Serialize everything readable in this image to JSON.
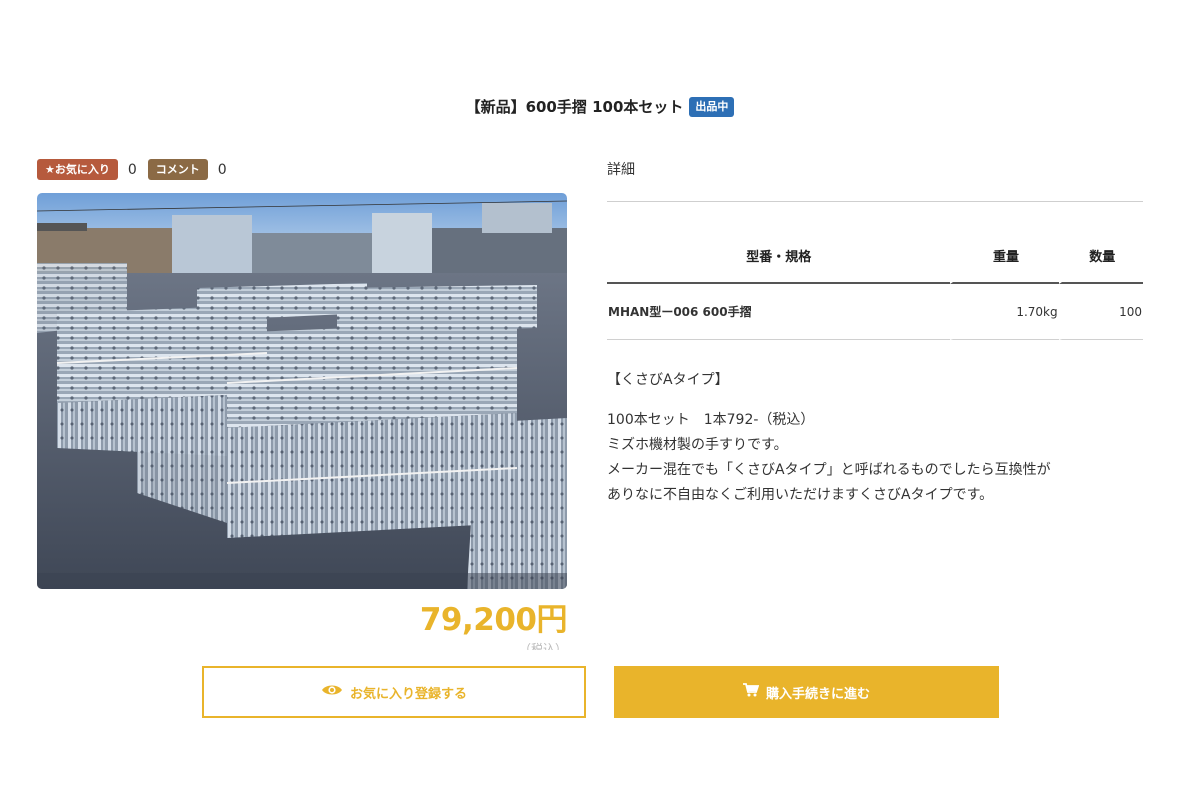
{
  "product": {
    "title": "【新品】600手摺 100本セット",
    "status": "出品中"
  },
  "stats": {
    "favorite_label": "★お気に入り",
    "favorite_count": "0",
    "comment_label": "コメント",
    "comment_count": "0"
  },
  "price": {
    "amount": "79,200円",
    "note": "（税込）"
  },
  "details": {
    "heading": "詳細",
    "table": {
      "headers": [
        "型番・規格",
        "重量",
        "数量"
      ],
      "rows": [
        {
          "model": "MHAN型ー006 600手摺",
          "weight": "1.70kg",
          "qty": "100"
        }
      ]
    },
    "type_line": "【くさびAタイプ】",
    "lines": [
      "100本セット　1本792-（税込）",
      "ミズホ機材製の手すりです。",
      "メーカー混在でも「くさびAタイプ」と呼ばれるものでしたら互換性が",
      "ありなに不自由なくご利用いただけますくさびAタイプです。"
    ]
  },
  "actions": {
    "favorite_button": "お気に入り登録する",
    "buy_button": "購入手続きに進む"
  },
  "icons": {
    "favorite_button_icon": "eye-icon",
    "buy_button_icon": "cart-icon"
  },
  "colors": {
    "accent": "#e9b42b",
    "status_badge": "#2d6fb5",
    "favorite_tag": "#b65a3d",
    "comment_tag": "#8b6a45"
  }
}
